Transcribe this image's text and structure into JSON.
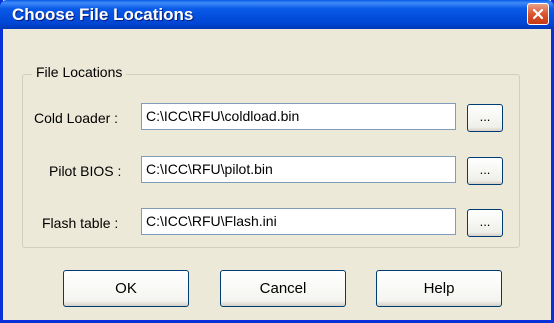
{
  "window": {
    "title": "Choose File Locations"
  },
  "group": {
    "label": "File Locations"
  },
  "rows": [
    {
      "label": "Cold Loader :",
      "value": "C:\\ICC\\RFU\\coldload.bin",
      "browse": "..."
    },
    {
      "label": "Pilot BIOS :",
      "value": "C:\\ICC\\RFU\\pilot.bin",
      "browse": "..."
    },
    {
      "label": "Flash table :",
      "value": "C:\\ICC\\RFU\\Flash.ini",
      "browse": "..."
    }
  ],
  "buttons": {
    "ok": "OK",
    "cancel": "Cancel",
    "help": "Help"
  },
  "colors": {
    "titlebar": "#0a5ae8",
    "close": "#d9542f",
    "dialog_bg": "#ece9d8"
  }
}
